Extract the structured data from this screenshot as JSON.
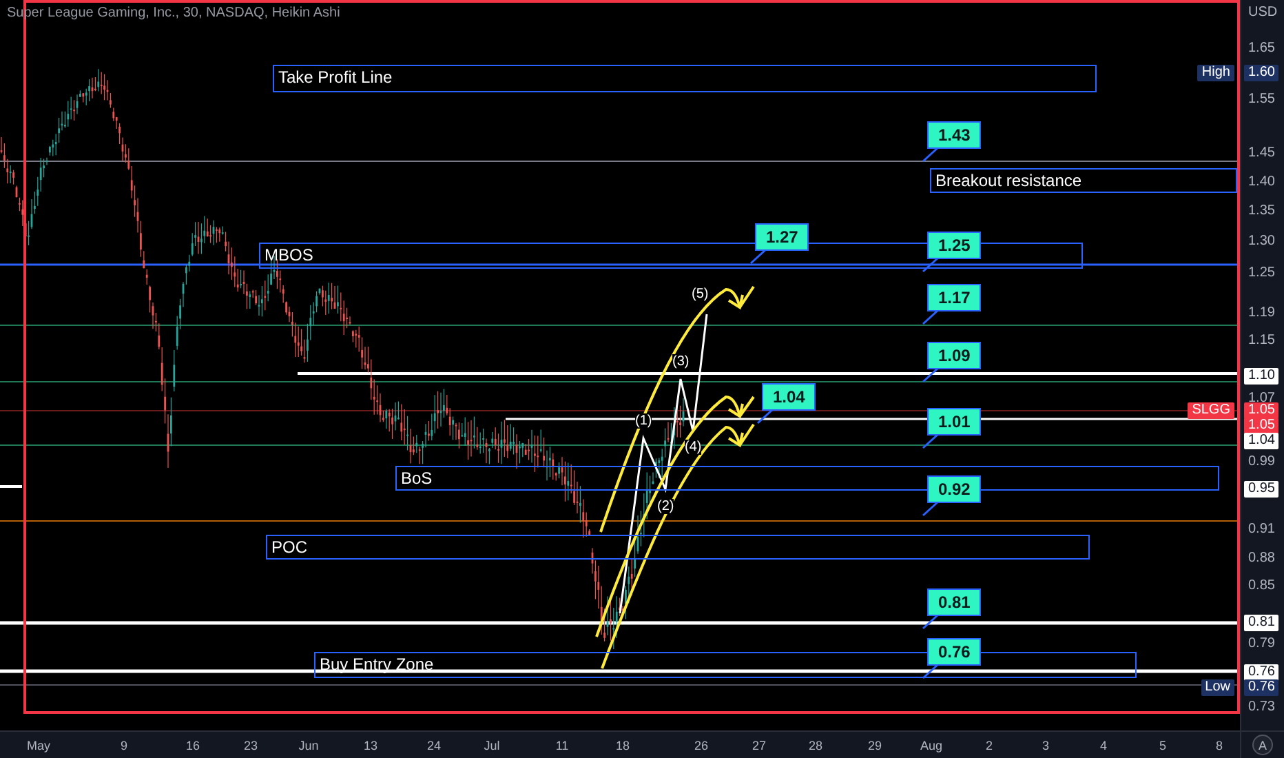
{
  "chart": {
    "title": "Super League Gaming, Inc., 30, NASDAQ, Heikin Ashi",
    "zones": [
      {
        "label": "Take Profit Line"
      },
      {
        "label": "Breakout resistance"
      },
      {
        "label": "MBOS"
      },
      {
        "label": "BoS"
      },
      {
        "label": "POC"
      },
      {
        "label": "Buy Entry Zone"
      }
    ],
    "callouts": [
      {
        "text": "1.43"
      },
      {
        "text": "1.27"
      },
      {
        "text": "1.25"
      },
      {
        "text": "1.17"
      },
      {
        "text": "1.09"
      },
      {
        "text": "1.04"
      },
      {
        "text": "1.01"
      },
      {
        "text": "0.92"
      },
      {
        "text": "0.81"
      },
      {
        "text": "0.76"
      }
    ],
    "wave_labels": [
      "(1)",
      "(2)",
      "(3)",
      "(4)",
      "(5)"
    ]
  },
  "price_axis": {
    "unit": "USD",
    "ticks": [
      "1.65",
      "1.55",
      "1.45",
      "1.40",
      "1.35",
      "1.30",
      "1.25",
      "1.19",
      "1.15",
      "1.07",
      "0.99",
      "0.91",
      "0.88",
      "0.85",
      "0.79",
      "0.73"
    ],
    "price_tags": [
      {
        "kind": "high",
        "label": "High",
        "value": "1.60"
      },
      {
        "kind": "line",
        "value": "1.10"
      },
      {
        "kind": "symbol",
        "label": "SLGG",
        "value": "1.05"
      },
      {
        "kind": "last",
        "value": "1.05"
      },
      {
        "kind": "line",
        "value": "1.04"
      },
      {
        "kind": "line",
        "value": "0.95"
      },
      {
        "kind": "line",
        "value": "0.81"
      },
      {
        "kind": "line",
        "value": "0.76"
      },
      {
        "kind": "low",
        "label": "Low",
        "value": "0.76"
      }
    ]
  },
  "time_axis": {
    "labels": [
      "May",
      "9",
      "16",
      "23",
      "Jun",
      "13",
      "24",
      "Jul",
      "11",
      "18",
      "26",
      "27",
      "28",
      "29",
      "Aug",
      "2",
      "3",
      "4",
      "5",
      "8"
    ],
    "auto_button": "A"
  }
}
